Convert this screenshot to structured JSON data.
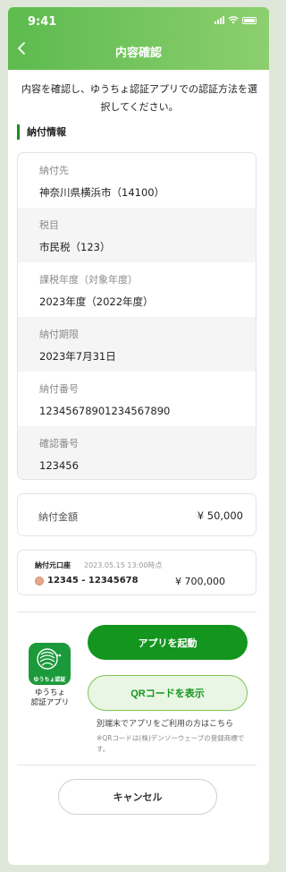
{
  "status_bar": {
    "time": "9:41"
  },
  "header": {
    "back_icon": "chevron-left-icon",
    "title": "内容確認"
  },
  "intro": {
    "line1": "内容を確認し、ゆうちょ認証アプリでの認証方法を選",
    "line2": "択してください。"
  },
  "section": {
    "title": "納付情報"
  },
  "info_rows": [
    {
      "label": "納付先",
      "value": "神奈川県横浜市（14100）"
    },
    {
      "label": "税目",
      "value": "市民税（123）"
    },
    {
      "label": "課税年度（対象年度）",
      "value": "2023年度（2022年度）"
    },
    {
      "label": "納付期限",
      "value": "2023年7月31日"
    },
    {
      "label": "納付番号",
      "value": "12345678901234567890"
    },
    {
      "label": "確認番号",
      "value": "123456"
    }
  ],
  "amount": {
    "label": "納付金額",
    "value": "¥ 50,000"
  },
  "account": {
    "label": "納付元口座",
    "timestamp": "2023.05.15 13:00時点",
    "number": "12345 - 12345678",
    "balance": "¥ 700,000"
  },
  "app": {
    "icon_label": "ゆうちょ認証",
    "name_line1": "ゆうちょ",
    "name_line2": "認証アプリ"
  },
  "buttons": {
    "launch": "アプリを起動",
    "qr": "QRコードを表示",
    "cancel": "キャンセル"
  },
  "notes": {
    "main": "別端末でアプリをご利用の方はこちら",
    "small": "※QRコードは(株)デンソーウェーブの登録商標です。"
  },
  "colors": {
    "brand_green": "#13951e",
    "header_start": "#5dbb4e",
    "header_end": "#8ccf6e"
  }
}
